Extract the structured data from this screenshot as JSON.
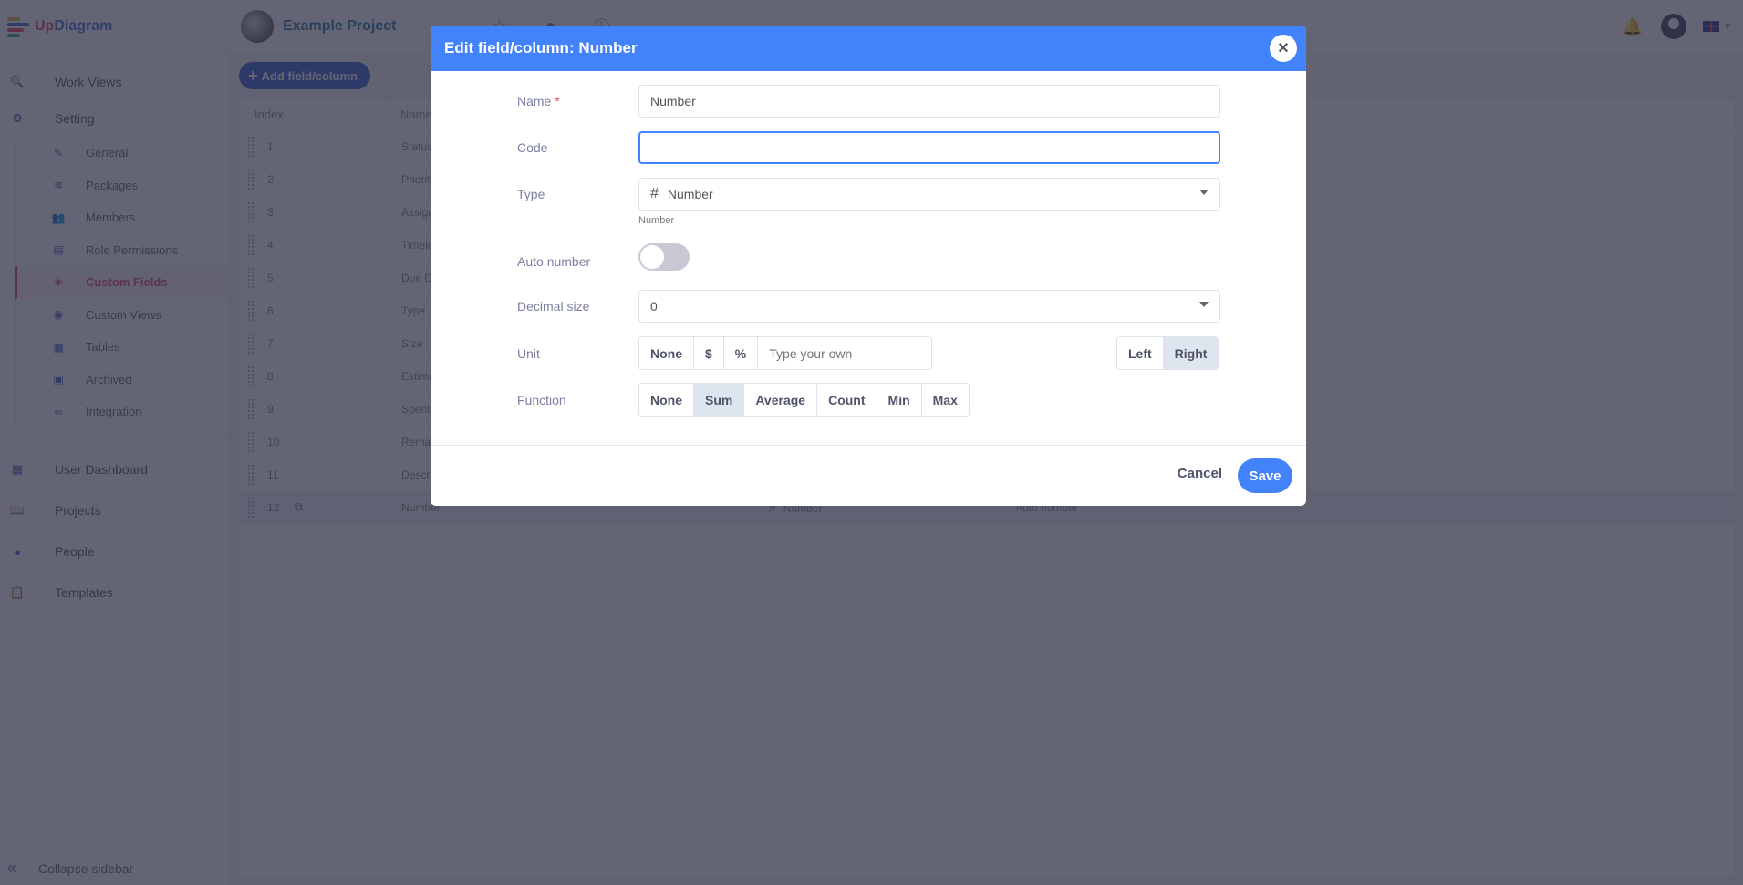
{
  "app": {
    "logo_up": "Up",
    "logo_diagram": "Diagram"
  },
  "topbar": {
    "project_name": "Example Project"
  },
  "sidebar": {
    "work_views": "Work Views",
    "setting": "Setting",
    "sub_items": [
      {
        "label": "General",
        "icon": "✎"
      },
      {
        "label": "Packages",
        "icon": "≋"
      },
      {
        "label": "Members",
        "icon": "👥"
      },
      {
        "label": "Role Permissions",
        "icon": "▤"
      },
      {
        "label": "Custom Fields",
        "icon": "✶",
        "active": true
      },
      {
        "label": "Custom Views",
        "icon": "◉"
      },
      {
        "label": "Tables",
        "icon": "▦"
      },
      {
        "label": "Archived",
        "icon": "▣"
      },
      {
        "label": "Integration",
        "icon": "∞"
      }
    ],
    "user_dashboard": "User Dashboard",
    "projects": "Projects",
    "people": "People",
    "templates": "Templates",
    "collapse": "Collapse sidebar"
  },
  "main": {
    "add_button": "Add field/column",
    "columns": {
      "index": "Index",
      "name": "Name"
    },
    "rows": [
      {
        "index": "1",
        "name": "Status"
      },
      {
        "index": "2",
        "name": "Priority"
      },
      {
        "index": "3",
        "name": "Assignee"
      },
      {
        "index": "4",
        "name": "Timeline"
      },
      {
        "index": "5",
        "name": "Due Date"
      },
      {
        "index": "6",
        "name": "Type"
      },
      {
        "index": "7",
        "name": "Size"
      },
      {
        "index": "8",
        "name": "Estimate"
      },
      {
        "index": "9",
        "name": "Spent"
      },
      {
        "index": "10",
        "name": "Remaining"
      },
      {
        "index": "11",
        "name": "Description"
      },
      {
        "index": "12",
        "name": "Number",
        "type": "Number",
        "extra": "Auto number"
      }
    ]
  },
  "modal": {
    "title": "Edit field/column: Number",
    "name_label": "Name",
    "name_required": "*",
    "name_value": "Number",
    "code_label": "Code",
    "code_value": "",
    "type_label": "Type",
    "type_value": "Number",
    "type_hint": "Number",
    "auto_number_label": "Auto number",
    "auto_number_on": false,
    "decimal_label": "Decimal size",
    "decimal_value": "0",
    "unit_label": "Unit",
    "unit_options": [
      "None",
      "$",
      "%"
    ],
    "unit_placeholder": "Type your own",
    "align_options": [
      "Left",
      "Right"
    ],
    "align_selected": "Right",
    "function_label": "Function",
    "function_options": [
      "None",
      "Sum",
      "Average",
      "Count",
      "Min",
      "Max"
    ],
    "function_selected": "Sum",
    "cancel": "Cancel",
    "save": "Save"
  }
}
